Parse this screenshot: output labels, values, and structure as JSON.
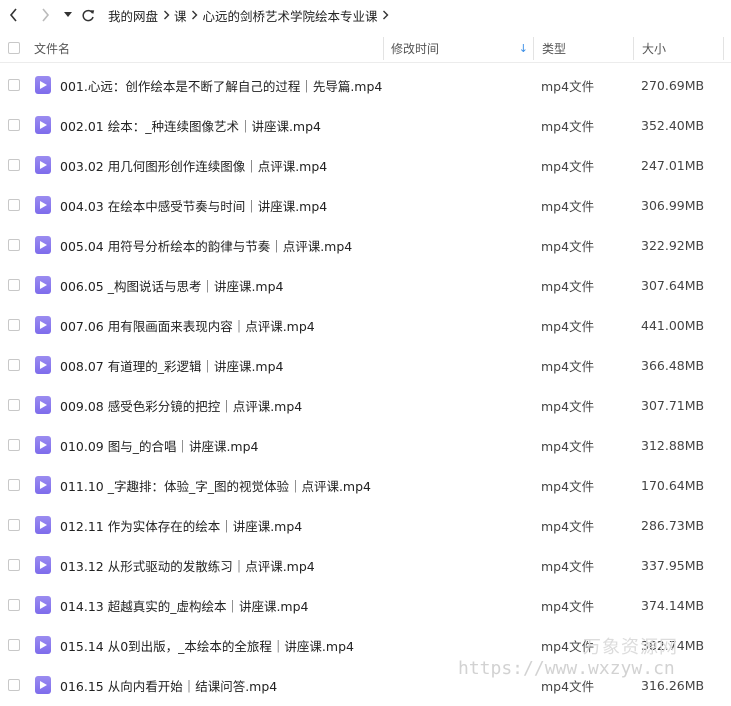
{
  "nav": {
    "breadcrumb": [
      "我的网盘",
      "课",
      "心远的剑桥艺术学院绘本专业课"
    ]
  },
  "columns": {
    "name": "文件名",
    "date": "修改时间",
    "type": "类型",
    "size": "大小"
  },
  "files": [
    {
      "name": "001.心远：创作绘本是不断了解自己的过程｜先导篇.mp4",
      "type": "mp4文件",
      "size": "270.69MB"
    },
    {
      "name": "002.01 绘本：_种连续图像艺术｜讲座课.mp4",
      "type": "mp4文件",
      "size": "352.40MB"
    },
    {
      "name": "003.02 用几何图形创作连续图像｜点评课.mp4",
      "type": "mp4文件",
      "size": "247.01MB"
    },
    {
      "name": "004.03 在绘本中感受节奏与时间｜讲座课.mp4",
      "type": "mp4文件",
      "size": "306.99MB"
    },
    {
      "name": "005.04 用符号分析绘本的韵律与节奏｜点评课.mp4",
      "type": "mp4文件",
      "size": "322.92MB"
    },
    {
      "name": "006.05 _构图说话与思考｜讲座课.mp4",
      "type": "mp4文件",
      "size": "307.64MB"
    },
    {
      "name": "007.06 用有限画面来表现内容｜点评课.mp4",
      "type": "mp4文件",
      "size": "441.00MB"
    },
    {
      "name": "008.07 有道理的_彩逻辑｜讲座课.mp4",
      "type": "mp4文件",
      "size": "366.48MB"
    },
    {
      "name": "009.08 感受色彩分镜的把控｜点评课.mp4",
      "type": "mp4文件",
      "size": "307.71MB"
    },
    {
      "name": "010.09 图与_的合唱｜讲座课.mp4",
      "type": "mp4文件",
      "size": "312.88MB"
    },
    {
      "name": "011.10 _字趣排：体验_字_图的视觉体验｜点评课.mp4",
      "type": "mp4文件",
      "size": "170.64MB"
    },
    {
      "name": "012.11 作为实体存在的绘本｜讲座课.mp4",
      "type": "mp4文件",
      "size": "286.73MB"
    },
    {
      "name": "013.12 从形式驱动的发散练习｜点评课.mp4",
      "type": "mp4文件",
      "size": "337.95MB"
    },
    {
      "name": "014.13 超越真实的_虚构绘本｜讲座课.mp4",
      "type": "mp4文件",
      "size": "374.14MB"
    },
    {
      "name": "015.14 从0到出版，_本绘本的全旅程｜讲座课.mp4",
      "type": "mp4文件",
      "size": "382.74MB"
    },
    {
      "name": "016.15 从向内看开始｜结课问答.mp4",
      "type": "mp4文件",
      "size": "316.26MB"
    }
  ],
  "watermark": {
    "logo": "万象资源网",
    "url": "https://www.wxzyw.cn"
  },
  "colors": {
    "file_icon": "#8a7aee",
    "sort_arrow": "#3a8ee6",
    "header_text": "#555555"
  },
  "icons": [
    "back-arrow-icon",
    "forward-arrow-icon",
    "dropdown-caret-icon",
    "refresh-icon",
    "chevron-right-icon",
    "sort-down-arrow-icon",
    "video-file-icon"
  ]
}
